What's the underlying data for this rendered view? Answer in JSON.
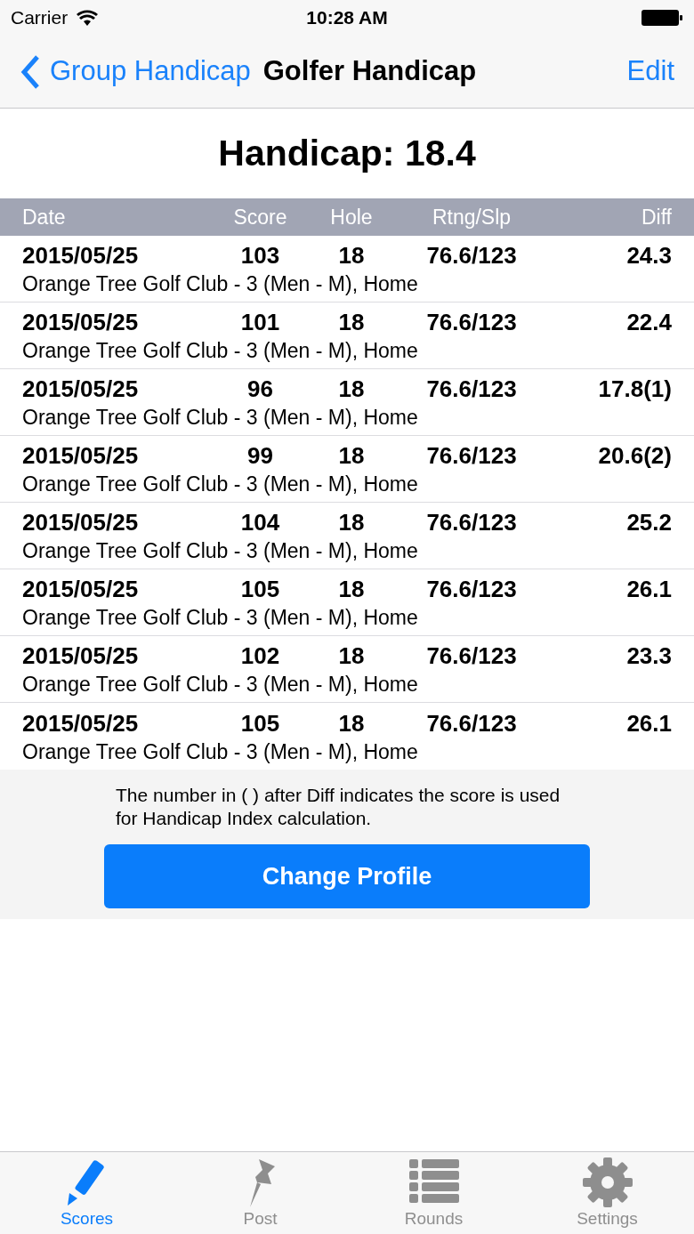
{
  "status_bar": {
    "carrier": "Carrier",
    "time": "10:28 AM"
  },
  "nav_bar": {
    "back": "Group Handicap",
    "title": "Golfer Handicap",
    "action": "Edit"
  },
  "handicap": "Handicap: 18.4",
  "table": {
    "columns": [
      "Date",
      "Score",
      "Hole",
      "Rtng/Slp",
      "Diff"
    ],
    "rows": [
      {
        "date": "2015/05/25",
        "score": "103",
        "hole": "18",
        "rating": "76.6/123",
        "diff": "24.3",
        "course": "Orange Tree Golf Club - 3 (Men - M), Home"
      },
      {
        "date": "2015/05/25",
        "score": "101",
        "hole": "18",
        "rating": "76.6/123",
        "diff": "22.4",
        "course": "Orange Tree Golf Club - 3 (Men - M), Home"
      },
      {
        "date": "2015/05/25",
        "score": "96",
        "hole": "18",
        "rating": "76.6/123",
        "diff": "17.8(1)",
        "course": "Orange Tree Golf Club - 3 (Men - M), Home"
      },
      {
        "date": "2015/05/25",
        "score": "99",
        "hole": "18",
        "rating": "76.6/123",
        "diff": "20.6(2)",
        "course": "Orange Tree Golf Club - 3 (Men - M), Home"
      },
      {
        "date": "2015/05/25",
        "score": "104",
        "hole": "18",
        "rating": "76.6/123",
        "diff": "25.2",
        "course": "Orange Tree Golf Club - 3 (Men - M), Home"
      },
      {
        "date": "2015/05/25",
        "score": "105",
        "hole": "18",
        "rating": "76.6/123",
        "diff": "26.1",
        "course": "Orange Tree Golf Club - 3 (Men - M), Home"
      },
      {
        "date": "2015/05/25",
        "score": "102",
        "hole": "18",
        "rating": "76.6/123",
        "diff": "23.3",
        "course": "Orange Tree Golf Club - 3 (Men - M), Home"
      },
      {
        "date": "2015/05/25",
        "score": "105",
        "hole": "18",
        "rating": "76.6/123",
        "diff": "26.1",
        "course": "Orange Tree Golf Club - 3 (Men - M), Home"
      }
    ]
  },
  "note": "The number in ( ) after Diff indicates the score is used for Handicap Index calculation.",
  "button": "Change Profile",
  "tab_bar": [
    {
      "kind": "pencil",
      "label": "Scores",
      "selected": true
    },
    {
      "kind": "pin",
      "label": "Post",
      "selected": false
    },
    {
      "kind": "list",
      "label": "Rounds",
      "selected": false
    },
    {
      "kind": "gear",
      "label": "Settings",
      "selected": false
    }
  ]
}
